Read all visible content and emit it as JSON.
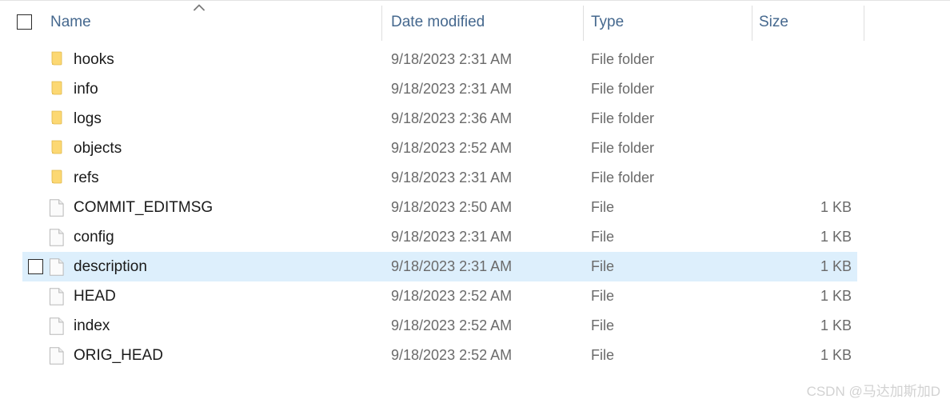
{
  "header": {
    "sort_indicator_icon": "chevron-up-icon",
    "select_all_checkbox_checked": false,
    "columns": [
      {
        "key": "name",
        "label": "Name"
      },
      {
        "key": "date",
        "label": "Date modified"
      },
      {
        "key": "type",
        "label": "Type"
      },
      {
        "key": "size",
        "label": "Size"
      }
    ]
  },
  "files": [
    {
      "name": "hooks",
      "date": "9/18/2023 2:31 AM",
      "type": "File folder",
      "size": "",
      "icon": "folder-icon",
      "selected": false
    },
    {
      "name": "info",
      "date": "9/18/2023 2:31 AM",
      "type": "File folder",
      "size": "",
      "icon": "folder-icon",
      "selected": false
    },
    {
      "name": "logs",
      "date": "9/18/2023 2:36 AM",
      "type": "File folder",
      "size": "",
      "icon": "folder-icon",
      "selected": false
    },
    {
      "name": "objects",
      "date": "9/18/2023 2:52 AM",
      "type": "File folder",
      "size": "",
      "icon": "folder-icon",
      "selected": false
    },
    {
      "name": "refs",
      "date": "9/18/2023 2:31 AM",
      "type": "File folder",
      "size": "",
      "icon": "folder-icon",
      "selected": false
    },
    {
      "name": "COMMIT_EDITMSG",
      "date": "9/18/2023 2:50 AM",
      "type": "File",
      "size": "1 KB",
      "icon": "file-icon",
      "selected": false
    },
    {
      "name": "config",
      "date": "9/18/2023 2:31 AM",
      "type": "File",
      "size": "1 KB",
      "icon": "file-icon",
      "selected": false
    },
    {
      "name": "description",
      "date": "9/18/2023 2:31 AM",
      "type": "File",
      "size": "1 KB",
      "icon": "file-icon",
      "selected": true
    },
    {
      "name": "HEAD",
      "date": "9/18/2023 2:52 AM",
      "type": "File",
      "size": "1 KB",
      "icon": "file-icon",
      "selected": false
    },
    {
      "name": "index",
      "date": "9/18/2023 2:52 AM",
      "type": "File",
      "size": "1 KB",
      "icon": "file-icon",
      "selected": false
    },
    {
      "name": "ORIG_HEAD",
      "date": "9/18/2023 2:52 AM",
      "type": "File",
      "size": "1 KB",
      "icon": "file-icon",
      "selected": false
    }
  ],
  "watermark": {
    "text": "CSDN @马达加斯加D"
  },
  "colors": {
    "header_text": "#45688e",
    "row_text": "#1a1a1a",
    "secondary_text": "#6a6a6a",
    "selection": "#ddeffc",
    "folder": "#fcd975",
    "divider": "#dedede",
    "watermark": "#d2d2d2"
  }
}
